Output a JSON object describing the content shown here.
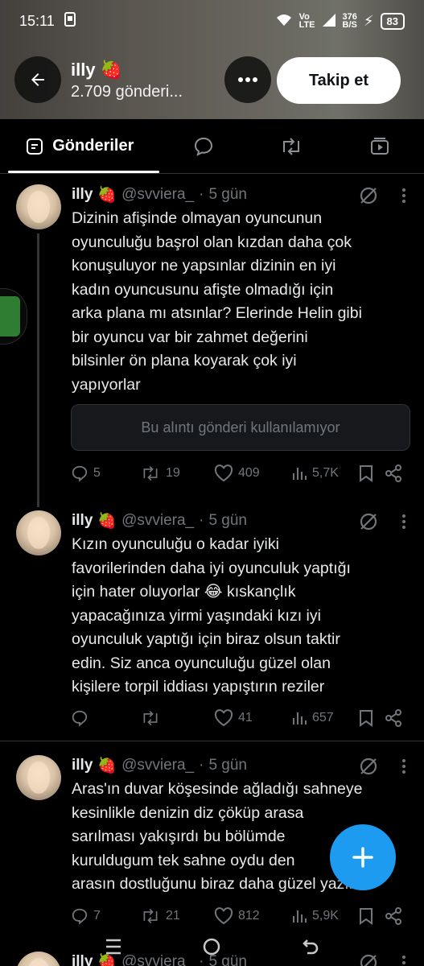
{
  "status_bar": {
    "time": "15:11",
    "network_lines": [
      "Vo",
      "LTE"
    ],
    "speed": "376",
    "speed_unit": "B/S",
    "battery": "83"
  },
  "header": {
    "name": "illy",
    "name_emoji": "🍓",
    "posts_count": "2.709 gönderi...",
    "follow_label": "Takip et"
  },
  "tabs": [
    {
      "label": "Gönderiler",
      "icon": "posts-icon",
      "active": true
    },
    {
      "label": "",
      "icon": "reply-bubble-icon",
      "active": false
    },
    {
      "label": "",
      "icon": "repost-icon",
      "active": false
    },
    {
      "label": "",
      "icon": "media-icon",
      "active": false
    }
  ],
  "tweets": [
    {
      "name": "illy",
      "emoji": "🍓",
      "handle": "@svviera_",
      "sep": "·",
      "time": "5 gün",
      "text_lines": [
        "Dizinin afişinde olmayan oyuncunun",
        "oyunculuğu başrol olan kızdan daha çok",
        "konuşuluyor ne yapsınlar dizinin en iyi",
        "kadın oyuncusunu afişte olmadığı için",
        "arka plana mı atsınlar? Elerinde Helin gibi",
        "bir oyuncu var bir zahmet değerini",
        "bilsinler ön plana koyarak çok iyi",
        "yapıyorlar"
      ],
      "quote": "Bu alıntı gönderi kullanılamıyor",
      "replies": "5",
      "reposts": "19",
      "likes": "409",
      "views": "5,7K"
    },
    {
      "name": "illy",
      "emoji": "🍓",
      "handle": "@svviera_",
      "sep": "·",
      "time": "5 gün",
      "text_lines": [
        "Kızın oyunculuğu o kadar iyiki",
        "favorilerinden daha iyi oyunculuk yaptığı",
        "için hater oluyorlar 😂 kıskançlık",
        "yapacağınıza yirmi yaşındaki kızı iyi",
        "oyunculuk yaptığı için biraz olsun taktir",
        "edin.  Siz anca oyunculuğu güzel olan",
        "kişilere torpil iddiası yapıştırın reziler"
      ],
      "replies": "",
      "reposts": "",
      "likes": "41",
      "views": "657"
    },
    {
      "name": "illy",
      "emoji": "🍓",
      "handle": "@svviera_",
      "sep": "·",
      "time": "5 gün",
      "text_lines": [
        "Aras'ın duvar köşesinde ağladığı sahneye",
        "kesinlikle denizin diz çöküp arasa",
        "sarılması yakışırdı bu bölümde",
        "kuruldugum tek sahne oydu den",
        "arasın dostluğunu biraz daha güzel yazın"
      ],
      "replies": "7",
      "reposts": "21",
      "likes": "812",
      "views": "5,9K"
    },
    {
      "name": "illy",
      "emoji": "🍓",
      "handle": "@svviera_",
      "sep": "·",
      "time": "5 gün"
    }
  ],
  "colors": {
    "accent": "#1d9bf0",
    "background": "#000000",
    "muted": "#71767b",
    "text": "#e7e9ea"
  }
}
